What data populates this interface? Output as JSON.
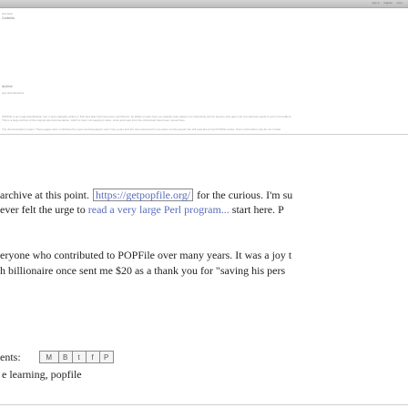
{
  "topbar": {
    "links": [
      "sign in",
      "register",
      "more"
    ]
  },
  "header_fragments": {
    "blog_title": "Contents",
    "small_line": "sub desc",
    "archive_title": "Archive",
    "archive_sub": "pop and reference"
  },
  "intro_paragraph": {
    "line1": "POPFile is an email classification tool. It was originally written in Perl and later had numerous contributors. Its ability to learn how you classify mail makes it an interesting tool for anyone who gets a lot of email and needs to sort it into folders.",
    "line2": "This is a large archive of the original site documentation, which is how I am keeping it alive. Links and code from the old domain have been moved here.",
    "line3": "The documentation project. These pages were contributed by users and developers over many years and are now preserved in one place so that people can still read about how POPFile works. Some information may be out of date."
  },
  "body": {
    "line1_prefix": "archive at this point.",
    "line1_link": "https://getpopfile.org/",
    "line1_suffix": "for the curious. I'm su",
    "line2_prefix": "ever felt the urge to",
    "line2_link": "read a very large Perl program...",
    "line2_suffix": "start here. P",
    "line3": "eryone who contributed to POPFile over many years. It was a joy t",
    "line4": "h billionaire once sent me $20 as a thank you for \"saving his pers"
  },
  "footer": {
    "comments_label": "ents:",
    "share_buttons": [
      {
        "label": "M",
        "icon": "email-icon"
      },
      {
        "label": "B",
        "icon": "blogthis-icon"
      },
      {
        "label": "t",
        "icon": "twitter-icon"
      },
      {
        "label": "f",
        "icon": "facebook-icon"
      },
      {
        "label": "P",
        "icon": "pinterest-icon"
      }
    ],
    "labels": "e learning, popfile"
  },
  "colors": {
    "link": "#5a6dbb",
    "text": "#222222",
    "topbar": "#c9c9c9"
  }
}
